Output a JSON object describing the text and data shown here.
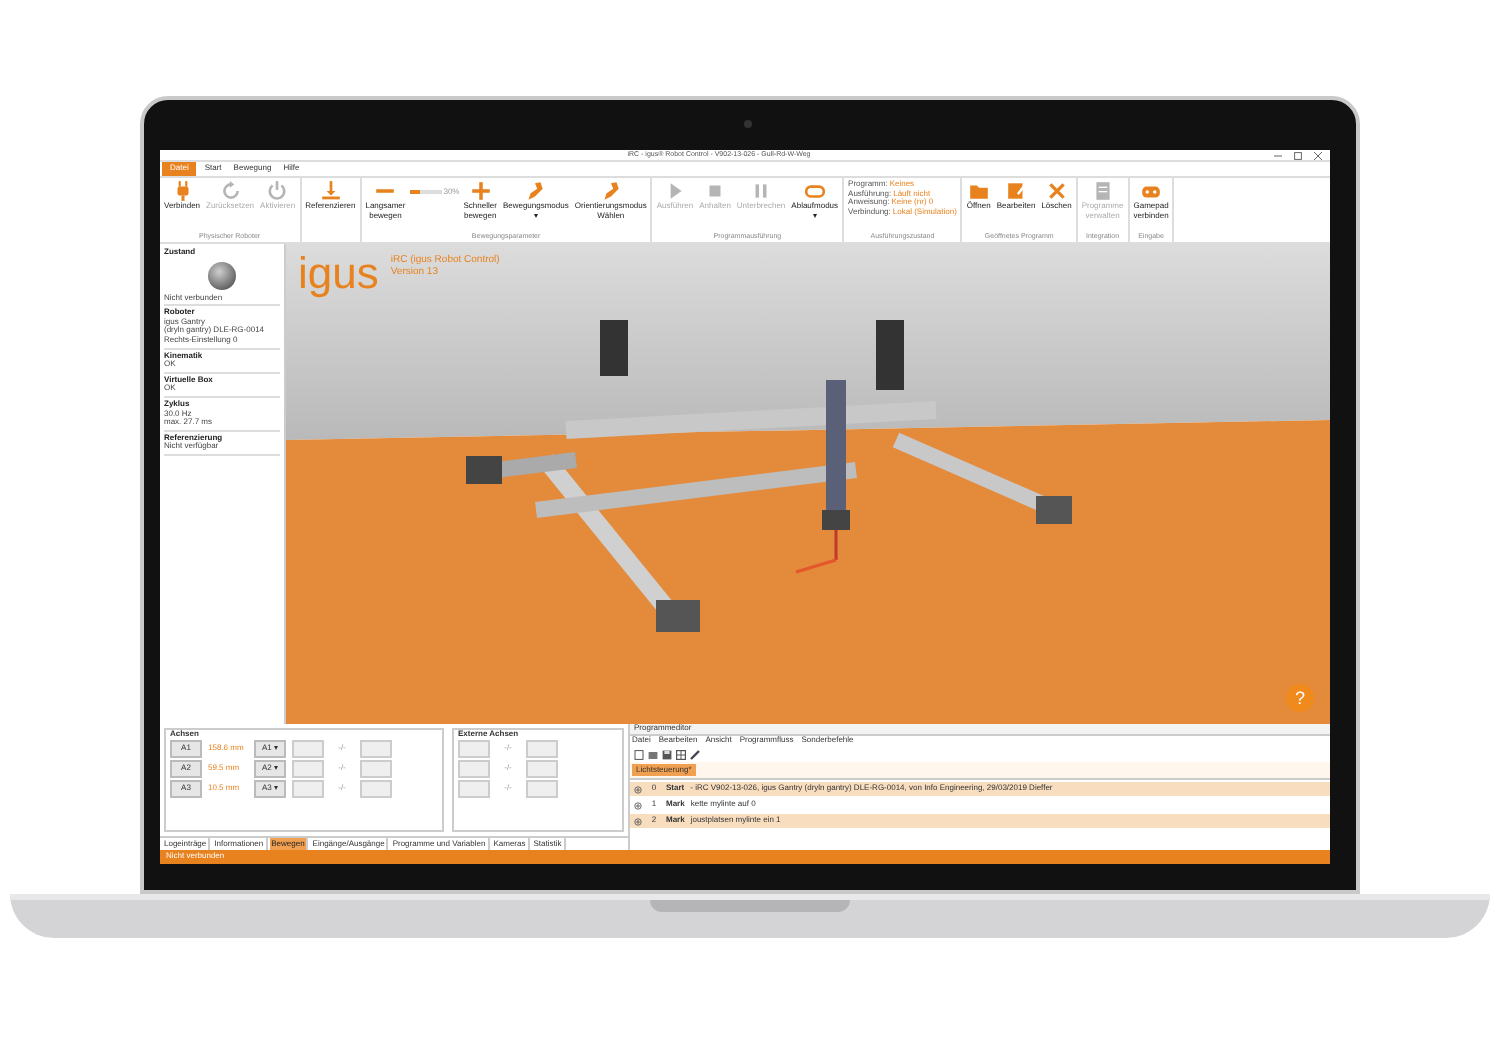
{
  "window": {
    "title": "iRC - igus® Robot Control - V902-13-026 - Gull-Rd-W-Weg"
  },
  "menu_tabs": [
    {
      "label": "Datei",
      "selected": true
    },
    {
      "label": "Start",
      "selected": false
    },
    {
      "label": "Bewegung",
      "selected": false
    },
    {
      "label": "Hilfe",
      "selected": false
    }
  ],
  "ribbon_groups": [
    {
      "label": "Physischer Roboter",
      "items": [
        {
          "kind": "button",
          "label": "Verbinden",
          "disabled": false
        },
        {
          "kind": "button",
          "label": "Zurücksetzen",
          "disabled": true
        },
        {
          "kind": "button",
          "label": "Aktivieren",
          "disabled": true
        }
      ]
    },
    {
      "items": [
        {
          "kind": "button",
          "label": "Referenzieren",
          "disabled": false
        }
      ]
    },
    {
      "label": "Bewegungsparameter",
      "items": [
        {
          "kind": "button",
          "label": "Langsamer\nbewegen",
          "disabled": false
        },
        {
          "kind": "slider",
          "level": 0.3,
          "reading": "30%"
        },
        {
          "kind": "button",
          "label": "Schneller\nbewegen",
          "disabled": false
        },
        {
          "kind": "button",
          "label": "Bewegungsmodus\n▾",
          "disabled": false
        },
        {
          "kind": "button",
          "label": "Orientierungsmodus\nWählen",
          "disabled": false
        }
      ]
    },
    {
      "label": "Programmausführung",
      "items": [
        {
          "kind": "button",
          "label": "Ausführen",
          "disabled": true
        },
        {
          "kind": "button",
          "label": "Anhalten",
          "disabled": true
        },
        {
          "kind": "button",
          "label": "Unterbrechen",
          "disabled": true
        },
        {
          "kind": "button",
          "label": "Ablaufmodus\n▾",
          "disabled": false
        }
      ]
    },
    {
      "label": "Ausführungszustand",
      "items": [
        {
          "kind": "status",
          "lines": [
            {
              "label": "Programm:",
              "value": "Keines"
            },
            {
              "label": "Ausführung:",
              "value": "Läuft nicht"
            },
            {
              "label": "Anweisung:",
              "value": "Keine (nr) 0"
            },
            {
              "label": "Verbindung:",
              "value": "Lokal (Simulation)"
            }
          ]
        }
      ]
    },
    {
      "label": "Geöffnetes Programm",
      "items": [
        {
          "kind": "button",
          "label": "Öffnen",
          "disabled": false
        },
        {
          "kind": "button",
          "label": "Bearbeiten",
          "disabled": false
        },
        {
          "kind": "button",
          "label": "Löschen",
          "disabled": false
        }
      ]
    },
    {
      "label": "Integration",
      "items": [
        {
          "kind": "button",
          "label": "Programme\nverwalten",
          "disabled": true
        }
      ]
    },
    {
      "label": "Eingabe",
      "items": [
        {
          "kind": "button",
          "label": "Gamepad\nverbinden",
          "disabled": false
        }
      ]
    }
  ],
  "status_panel": [
    {
      "heading": "Zustand",
      "kind": "lamp",
      "lines": [
        "Nicht verbunden"
      ]
    },
    {
      "heading": "Roboter",
      "kind": "text",
      "lines": [
        "igus Gantry",
        "(dryln gantry) DLE-RG-0014",
        "Rechts-Einstellung 0"
      ]
    },
    {
      "heading": "Kinematik",
      "kind": "text",
      "lines": [
        "OK"
      ]
    },
    {
      "heading": "Virtuelle Box",
      "kind": "text",
      "lines": [
        "OK"
      ]
    },
    {
      "heading": "Zyklus",
      "kind": "text",
      "lines": [
        "30.0 Hz",
        "max. 27.7 ms"
      ]
    },
    {
      "heading": "Referenzierung",
      "kind": "text",
      "lines": [
        "Nicht verfügbar"
      ]
    }
  ],
  "viewport": {
    "logo": "igus",
    "title": "iRC (igus Robot Control)",
    "version": "Version 13",
    "help": "?"
  },
  "axes": {
    "heading": "Achsen",
    "rows": [
      {
        "axis": "A1",
        "value": "158.6 mm",
        "select": "A1 ▾",
        "reading": "-/-"
      },
      {
        "axis": "A2",
        "value": "59.5 mm",
        "select": "A2 ▾",
        "reading": "-/-"
      },
      {
        "axis": "A3",
        "value": "10.5 mm",
        "select": "A3 ▾",
        "reading": "-/-"
      }
    ]
  },
  "external_axes": {
    "heading": "Externe Achsen",
    "rows": [
      {
        "reading": "-/-"
      },
      {
        "reading": "-/-"
      },
      {
        "reading": "-/-"
      }
    ]
  },
  "bottom_tabs": [
    {
      "label": "Logeinträge",
      "selected": false
    },
    {
      "label": "Informationen",
      "selected": false
    },
    {
      "label": "Bewegen",
      "selected": true
    },
    {
      "label": "Eingänge/Ausgänge",
      "selected": false
    },
    {
      "label": "Programme und Variablen",
      "selected": false
    },
    {
      "label": "Kameras",
      "selected": false
    },
    {
      "label": "Statistik",
      "selected": false
    }
  ],
  "editor": {
    "title": "Programmeditor",
    "menu": [
      "Datei",
      "Bearbeiten",
      "Ansicht",
      "Programmfluss",
      "Sonderbefehle"
    ],
    "file_tab": "Lichtsteuerung*",
    "rows": [
      {
        "number": "0",
        "keyword": "Start",
        "text": "- iRC V902-13-026, igus Gantry (dryln gantry) DLE-RG-0014, von Info Engineering, 29/03/2019 Dieffer",
        "highlighted": true
      },
      {
        "number": "1",
        "keyword": "Mark",
        "text": "kette mylinte auf 0",
        "highlighted": false
      },
      {
        "number": "2",
        "keyword": "Mark",
        "text": "joustplatsen mylinte ein 1",
        "highlighted": true
      }
    ]
  },
  "status_bar": "Nicht verbunden"
}
